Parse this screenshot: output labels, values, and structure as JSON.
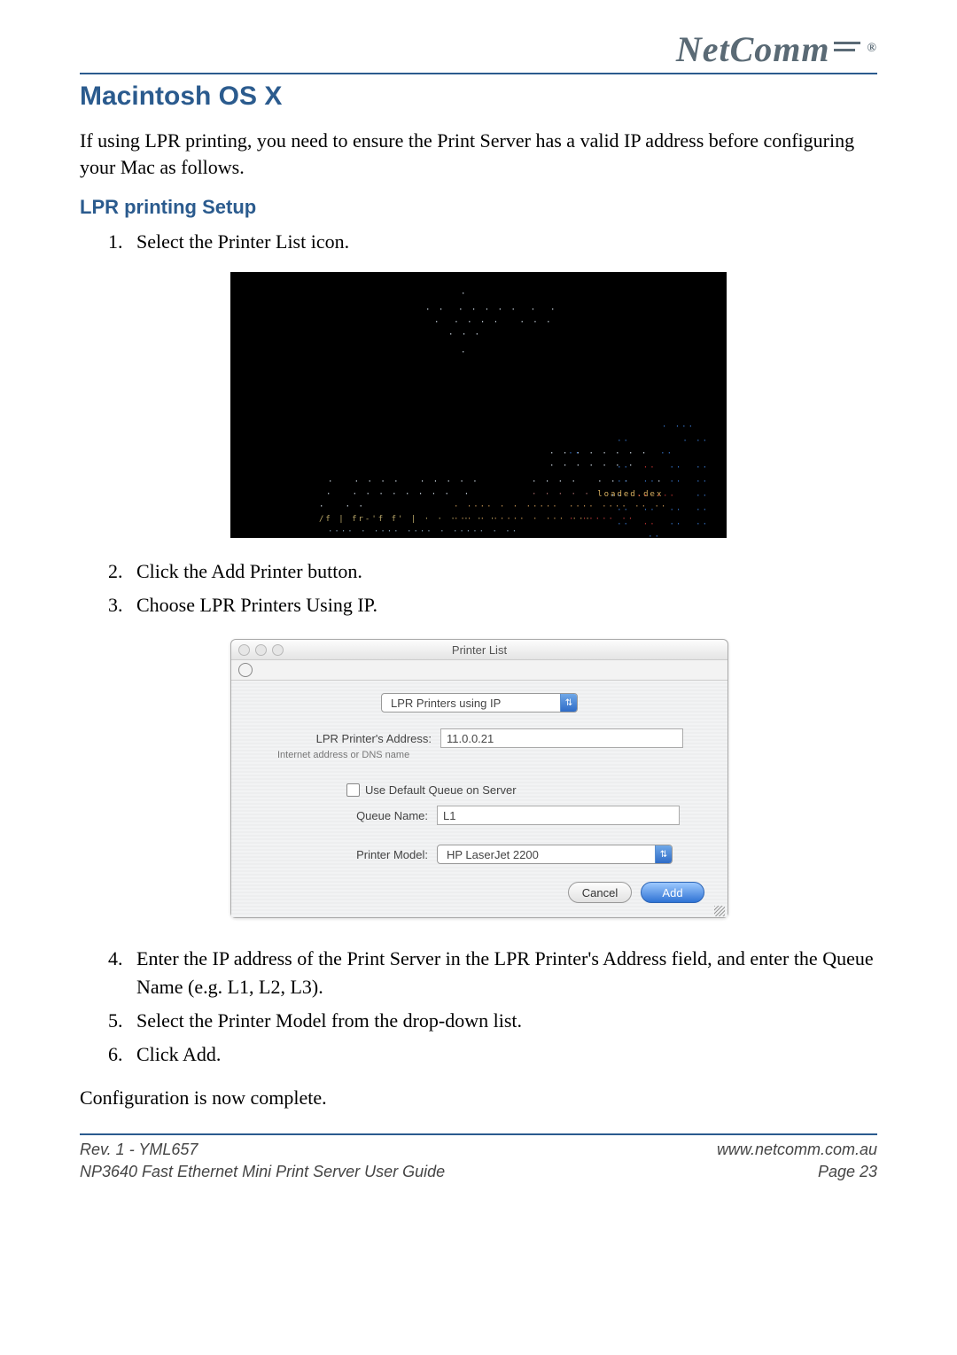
{
  "brand": {
    "name": "NetComm",
    "registered": "®"
  },
  "section_title": "Macintosh OS X",
  "intro": "If using LPR printing, you need to ensure the Print Server has a valid IP address before configuring your Mac as follows.",
  "subsection_title": "LPR printing Setup",
  "steps_part1": [
    "Select the Printer List icon."
  ],
  "steps_part2": [
    "Click the Add Printer button.",
    "Choose LPR Printers Using IP."
  ],
  "steps_part3": [
    "Enter the IP address of the Print Server in the LPR Printer's Address field, and enter the Queue Name (e.g. L1, L2, L3).",
    "Select the Printer Model from the drop-down list.",
    "Click Add."
  ],
  "conclusion": "Configuration is now complete.",
  "mac_window": {
    "title": "Printer List",
    "dropdown_value": "LPR Printers using IP",
    "address_label": "LPR Printer's Address:",
    "address_value": "11.0.0.21",
    "address_hint": "Internet address or DNS name",
    "default_queue_label": "Use Default Queue on Server",
    "queue_label": "Queue Name:",
    "queue_value": "L1",
    "model_label": "Printer Model:",
    "model_value": "HP LaserJet 2200",
    "cancel": "Cancel",
    "add": "Add"
  },
  "footer": {
    "rev": "Rev. 1 - YML657",
    "title": "NP3640 Fast Ethernet Mini Print Server User Guide",
    "url": "www.netcomm.com.au",
    "page": "Page 23"
  }
}
